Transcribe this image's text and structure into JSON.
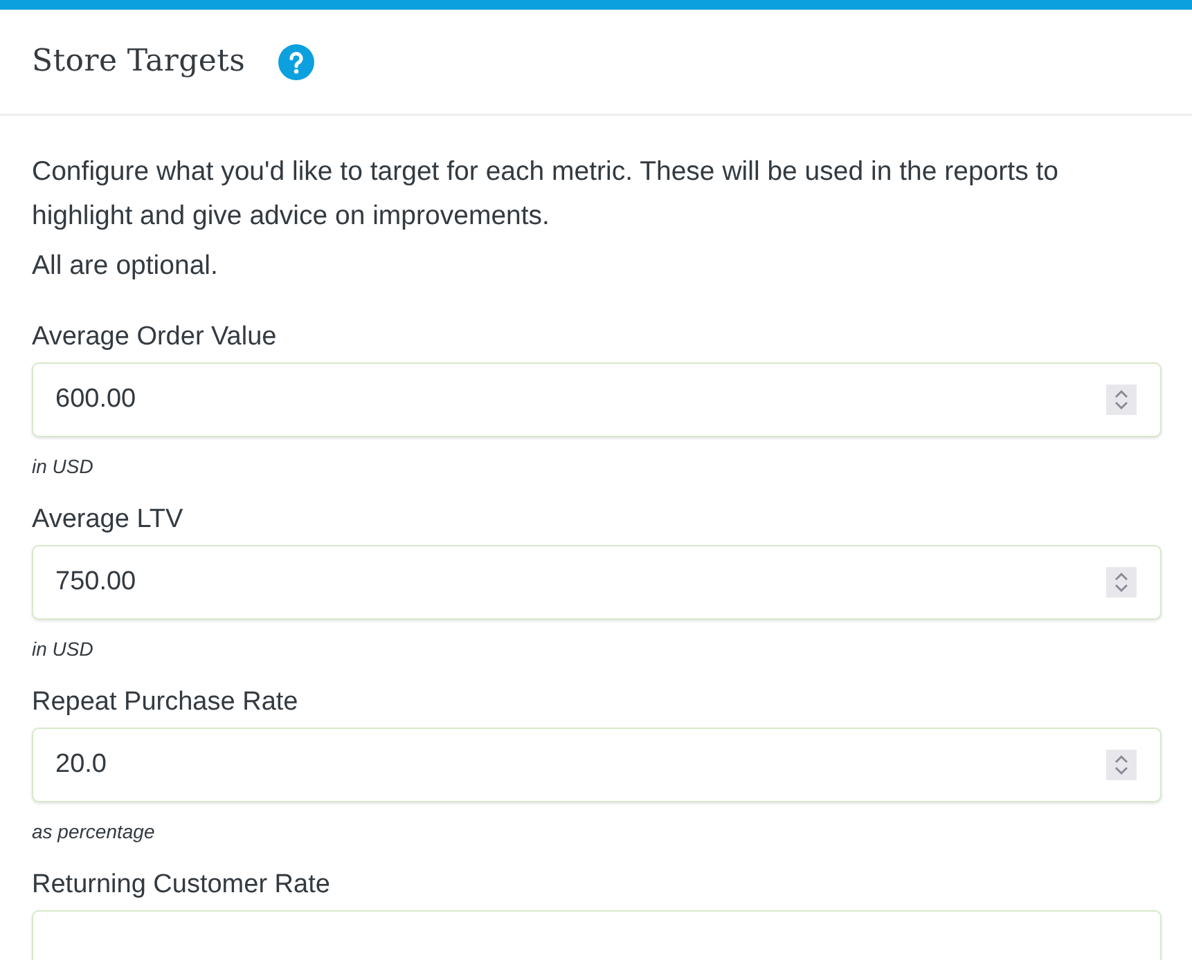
{
  "header": {
    "title": "Store Targets"
  },
  "intro": [
    "Configure what you'd like to target for each metric. These will be used in the reports to highlight and give advice on improvements.",
    "All are optional."
  ],
  "fields": [
    {
      "label": "Average Order Value",
      "value": "600.00",
      "hint": "in USD"
    },
    {
      "label": "Average LTV",
      "value": "750.00",
      "hint": "in USD"
    },
    {
      "label": "Repeat Purchase Rate",
      "value": "20.0",
      "hint": "as percentage"
    },
    {
      "label": "Returning Customer Rate"
    }
  ]
}
